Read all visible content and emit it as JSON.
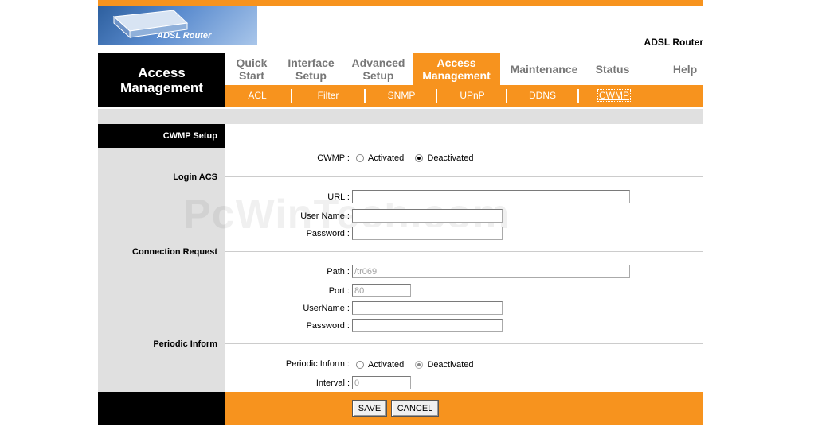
{
  "brand": {
    "logo_text": "ADSL Router",
    "model_name": "ADSL Router"
  },
  "header": {
    "section_title_line1": "Access",
    "section_title_line2": "Management"
  },
  "nav": {
    "tabs": [
      {
        "line1": "Quick",
        "line2": "Start"
      },
      {
        "line1": "Interface",
        "line2": "Setup"
      },
      {
        "line1": "Advanced",
        "line2": "Setup"
      },
      {
        "line1": "Access",
        "line2": "Management"
      },
      {
        "line1": "Maintenance",
        "line2": ""
      },
      {
        "line1": "Status",
        "line2": ""
      },
      {
        "line1": "Help",
        "line2": ""
      }
    ],
    "active_tab": "Access Management",
    "subtabs": [
      "ACL",
      "Filter",
      "SNMP",
      "UPnP",
      "DDNS",
      "CWMP"
    ],
    "active_subtab": "CWMP"
  },
  "page": {
    "section_head": "CWMP Setup",
    "watermark": "PcWinTech.com"
  },
  "cwmp": {
    "label": "CWMP :",
    "option_activated": "Activated",
    "option_deactivated": "Deactivated",
    "selected": "Deactivated"
  },
  "login_acs": {
    "title": "Login ACS",
    "url_label": "URL :",
    "url_value": "",
    "username_label": "User Name :",
    "username_value": "",
    "password_label": "Password :",
    "password_value": ""
  },
  "connection_request": {
    "title": "Connection Request",
    "path_label": "Path :",
    "path_value": "/tr069",
    "port_label": "Port :",
    "port_value": "80",
    "username_label": "UserName :",
    "username_value": "",
    "password_label": "Password :",
    "password_value": ""
  },
  "periodic_inform": {
    "title": "Periodic Inform",
    "label": "Periodic Inform :",
    "option_activated": "Activated",
    "option_deactivated": "Deactivated",
    "selected": "Deactivated",
    "interval_label": "Interval :",
    "interval_value": "0"
  },
  "actions": {
    "save_label": "SAVE",
    "cancel_label": "CANCEL"
  },
  "colors": {
    "accent": "#f7931e",
    "panel_gray": "#e0e0e0",
    "header_black": "#000000"
  }
}
